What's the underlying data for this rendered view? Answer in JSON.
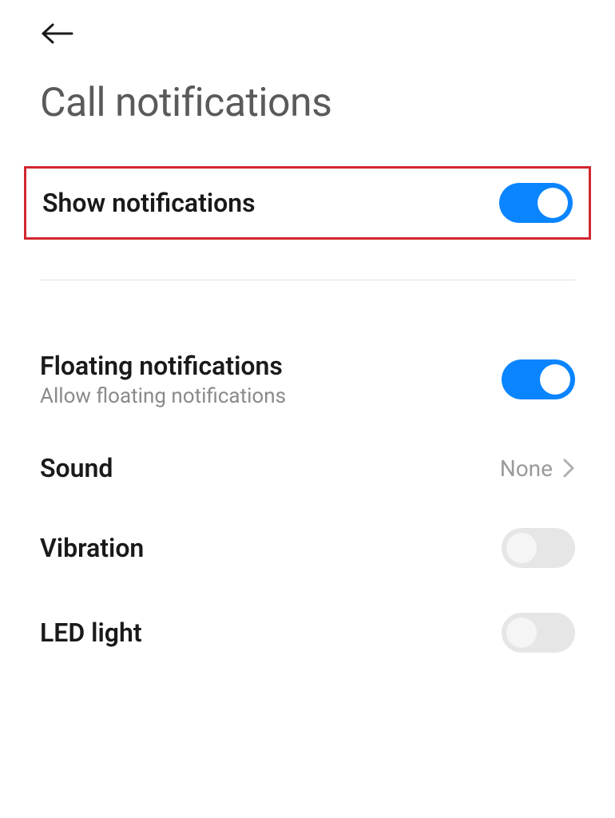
{
  "header": {
    "title": "Call notifications"
  },
  "settings": {
    "show_notifications": {
      "label": "Show notifications",
      "enabled": true
    },
    "floating_notifications": {
      "label": "Floating notifications",
      "subtitle": "Allow floating notifications",
      "enabled": true
    },
    "sound": {
      "label": "Sound",
      "value": "None"
    },
    "vibration": {
      "label": "Vibration",
      "enabled": false
    },
    "led_light": {
      "label": "LED light",
      "enabled": false
    }
  }
}
